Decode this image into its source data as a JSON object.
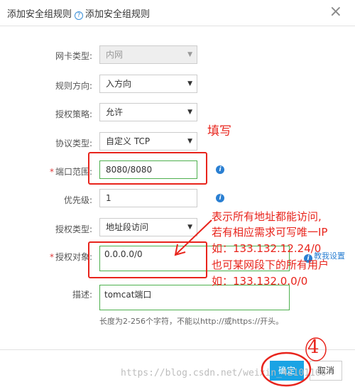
{
  "dialog": {
    "title_crumb": "添加安全组规则",
    "title": "添加安全组规则",
    "help_icon": "?"
  },
  "form": {
    "nic_type": {
      "label": "网卡类型:",
      "value": "内网"
    },
    "direction": {
      "label": "规则方向:",
      "value": "入方向"
    },
    "policy": {
      "label": "授权策略:",
      "value": "允许"
    },
    "protocol": {
      "label": "协议类型:",
      "value": "自定义 TCP"
    },
    "port_range": {
      "label": "端口范围:",
      "value": "8080/8080"
    },
    "priority": {
      "label": "优先级:",
      "value": "1"
    },
    "auth_type": {
      "label": "授权类型:",
      "value": "地址段访问"
    },
    "auth_object": {
      "label": "授权对象:",
      "value": "0.0.0.0/0"
    },
    "description": {
      "label": "描述:",
      "value": "tomcat端口",
      "hint": "长度为2-256个字符，不能以http://或https://开头。"
    },
    "tutorial_link": "教我设置",
    "info_icon": "i"
  },
  "footer": {
    "ok": "确定",
    "cancel": "取消"
  },
  "annotations": {
    "fill_in": "填写",
    "note_lines": [
      "表示所有地址都能访问,",
      "若有相应需求可写唯一IP",
      "如：133.132.12.24/0",
      "也可某网段下的所有用户",
      "如：133.132.0.0/0"
    ],
    "step_number": "4",
    "color": "#e8241c"
  },
  "watermark": "https://blog.csdn.net/weixin_42101166"
}
